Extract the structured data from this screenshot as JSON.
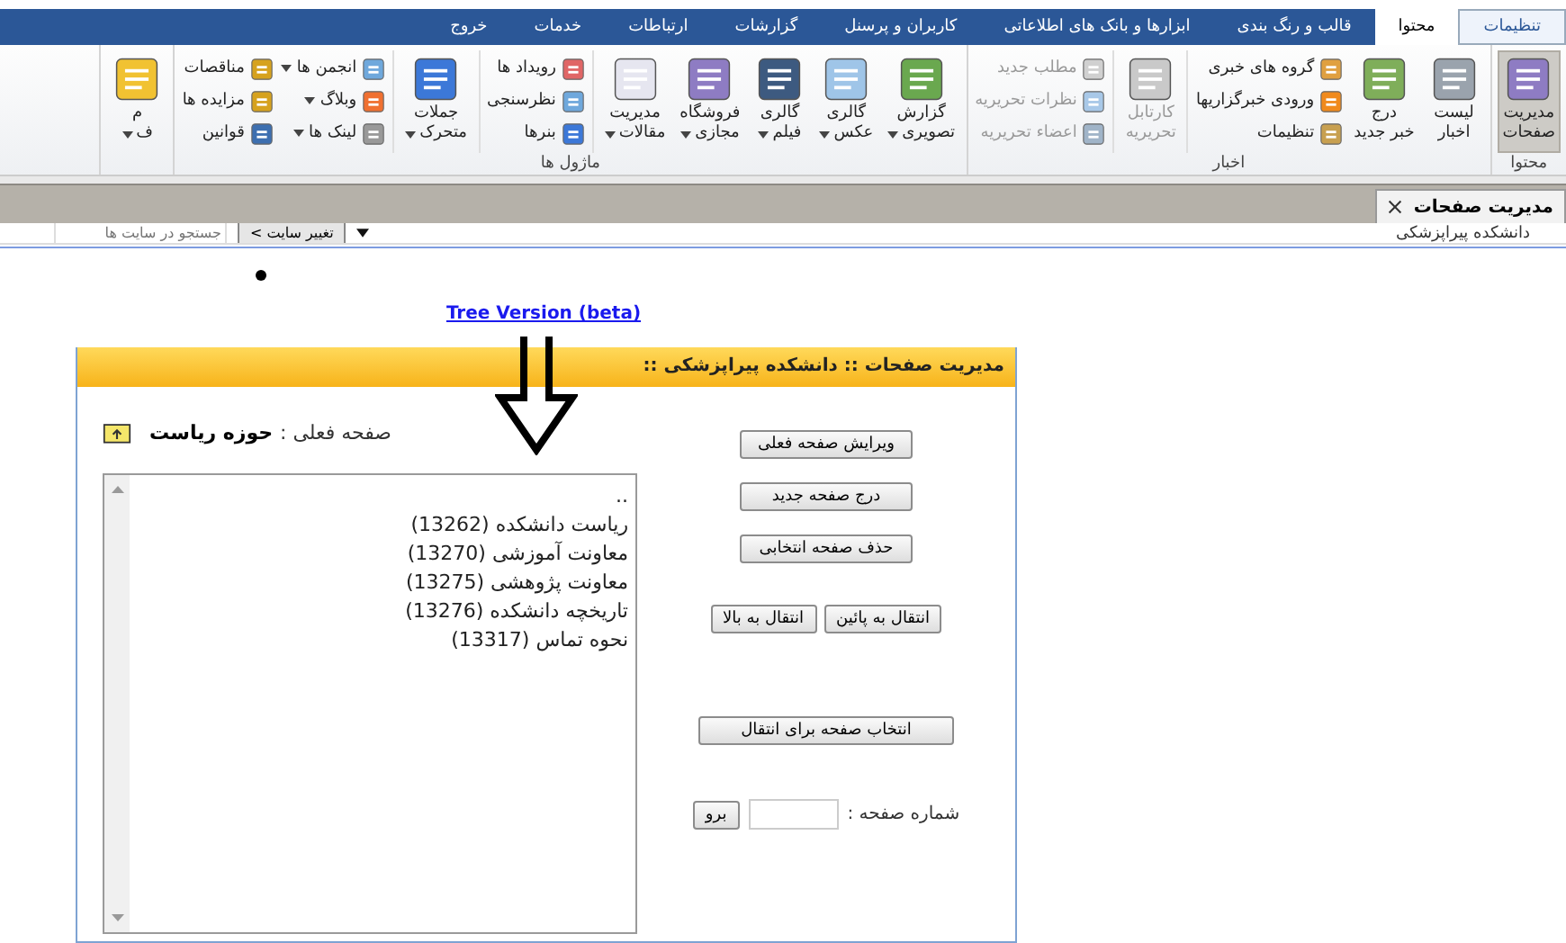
{
  "menu_tabs": [
    {
      "label": "تنظیمات",
      "kind": "app",
      "selected": false
    },
    {
      "label": "محتوا",
      "kind": "tab",
      "selected": true
    },
    {
      "label": "قالب و رنگ بندی",
      "kind": "tab",
      "selected": false
    },
    {
      "label": "ابزارها و بانک های اطلاعاتی",
      "kind": "tab",
      "selected": false
    },
    {
      "label": "کاربران و پرسنل",
      "kind": "tab",
      "selected": false
    },
    {
      "label": "گزارشات",
      "kind": "tab",
      "selected": false
    },
    {
      "label": "ارتباطات",
      "kind": "tab",
      "selected": false
    },
    {
      "label": "خدمات",
      "kind": "tab",
      "selected": false
    },
    {
      "label": "خروج",
      "kind": "tab",
      "selected": false
    }
  ],
  "ribbon": {
    "groups": [
      {
        "title": "محتوا",
        "sections": [
          [
            {
              "kind": "large",
              "lines": [
                "مدیریت",
                "صفحات"
              ],
              "dropdown": false,
              "selected": true,
              "disabled": false
            }
          ]
        ]
      },
      {
        "title": "اخبار",
        "sections": [
          [
            {
              "kind": "large",
              "lines": [
                "لیست",
                "اخبار"
              ],
              "dropdown": false,
              "selected": false,
              "disabled": false
            },
            {
              "kind": "large",
              "lines": [
                "درج",
                "خبر جدید"
              ],
              "dropdown": false,
              "selected": false,
              "disabled": false
            },
            {
              "kind": "stack",
              "items": [
                {
                  "label": "گروه های خبری",
                  "dropdown": false,
                  "disabled": false
                },
                {
                  "label": "ورودی خبرگزاریها",
                  "dropdown": false,
                  "disabled": false
                },
                {
                  "label": "تنظیمات",
                  "dropdown": false,
                  "disabled": false
                }
              ]
            }
          ],
          [
            {
              "kind": "large",
              "lines": [
                "کارتابل",
                "تحریریه"
              ],
              "dropdown": false,
              "selected": false,
              "disabled": true
            }
          ],
          [
            {
              "kind": "stack",
              "items": [
                {
                  "label": "مطلب جدید",
                  "dropdown": false,
                  "disabled": true
                },
                {
                  "label": "نظرات تحریریه",
                  "dropdown": false,
                  "disabled": true
                },
                {
                  "label": "اعضاء تحریریه",
                  "dropdown": false,
                  "disabled": true
                }
              ]
            }
          ]
        ]
      },
      {
        "title": "ماژول ها",
        "sections": [
          [
            {
              "kind": "large",
              "lines": [
                "گزارش",
                "تصویری"
              ],
              "dropdown": true,
              "selected": false,
              "disabled": false
            },
            {
              "kind": "large",
              "lines": [
                "گالری",
                "عکس"
              ],
              "dropdown": true,
              "selected": false,
              "disabled": false
            },
            {
              "kind": "large",
              "lines": [
                "گالری",
                "فیلم"
              ],
              "dropdown": true,
              "selected": false,
              "disabled": false
            },
            {
              "kind": "large",
              "lines": [
                "فروشگاه",
                "مجازی"
              ],
              "dropdown": true,
              "selected": false,
              "disabled": false
            },
            {
              "kind": "large",
              "lines": [
                "مدیریت",
                "مقالات"
              ],
              "dropdown": true,
              "selected": false,
              "disabled": false
            }
          ],
          [
            {
              "kind": "stack",
              "items": [
                {
                  "label": "رویداد ها",
                  "dropdown": false,
                  "disabled": false
                },
                {
                  "label": "نظرسنجی",
                  "dropdown": false,
                  "disabled": false
                },
                {
                  "label": "بنرها",
                  "dropdown": false,
                  "disabled": false
                }
              ]
            }
          ],
          [
            {
              "kind": "large",
              "lines": [
                "جملات",
                "متحرک"
              ],
              "dropdown": true,
              "selected": false,
              "disabled": false
            }
          ],
          [
            {
              "kind": "stack",
              "items": [
                {
                  "label": "انجمن ها",
                  "dropdown": true,
                  "disabled": false
                },
                {
                  "label": "وبلاگ",
                  "dropdown": true,
                  "disabled": false
                },
                {
                  "label": "لینک ها",
                  "dropdown": true,
                  "disabled": false
                }
              ]
            },
            {
              "kind": "stack",
              "items": [
                {
                  "label": "مناقصات",
                  "dropdown": false,
                  "disabled": false
                },
                {
                  "label": "مزایده ها",
                  "dropdown": false,
                  "disabled": false
                },
                {
                  "label": "قوانین",
                  "dropdown": false,
                  "disabled": false
                }
              ]
            }
          ]
        ]
      },
      {
        "sections": [
          [
            {
              "kind": "large",
              "lines": [
                "م",
                "ف"
              ],
              "dropdown": true,
              "selected": false,
              "disabled": false
            }
          ]
        ]
      }
    ]
  },
  "doc_tab": {
    "label": "مدیریت صفحات"
  },
  "site_bar": {
    "site": "دانشکده پیراپزشکی",
    "change_button": "تغییر سایت >",
    "search": {
      "placeholder": "جستجو در سایت ها"
    }
  },
  "tree_link": "Tree Version (beta)",
  "panel": {
    "title": "مدیریت صفحات :: دانشکده پیراپزشکی ::",
    "current_label": "صفحه فعلی :",
    "current_page": "حوزه رياست",
    "pages": [
      "..",
      "رياست دانشکده (13262)",
      "معاونت آموزشی (13270)",
      "معاونت پژوهشی (13275)",
      "تاریخچه دانشکده (13276)",
      "نحوه تماس (13317)"
    ],
    "edit_button": "ویرایش صفحه فعلی",
    "new_button": "درج صفحه جدید",
    "delete_button": "حذف صفحه انتخابی",
    "move_down_button": "انتقال به پائین",
    "move_up_button": "انتقال به بالا",
    "select_move_button": "انتخاب صفحه برای انتقال",
    "page_number_label": "شماره صفحه :",
    "go_button": "برو"
  }
}
